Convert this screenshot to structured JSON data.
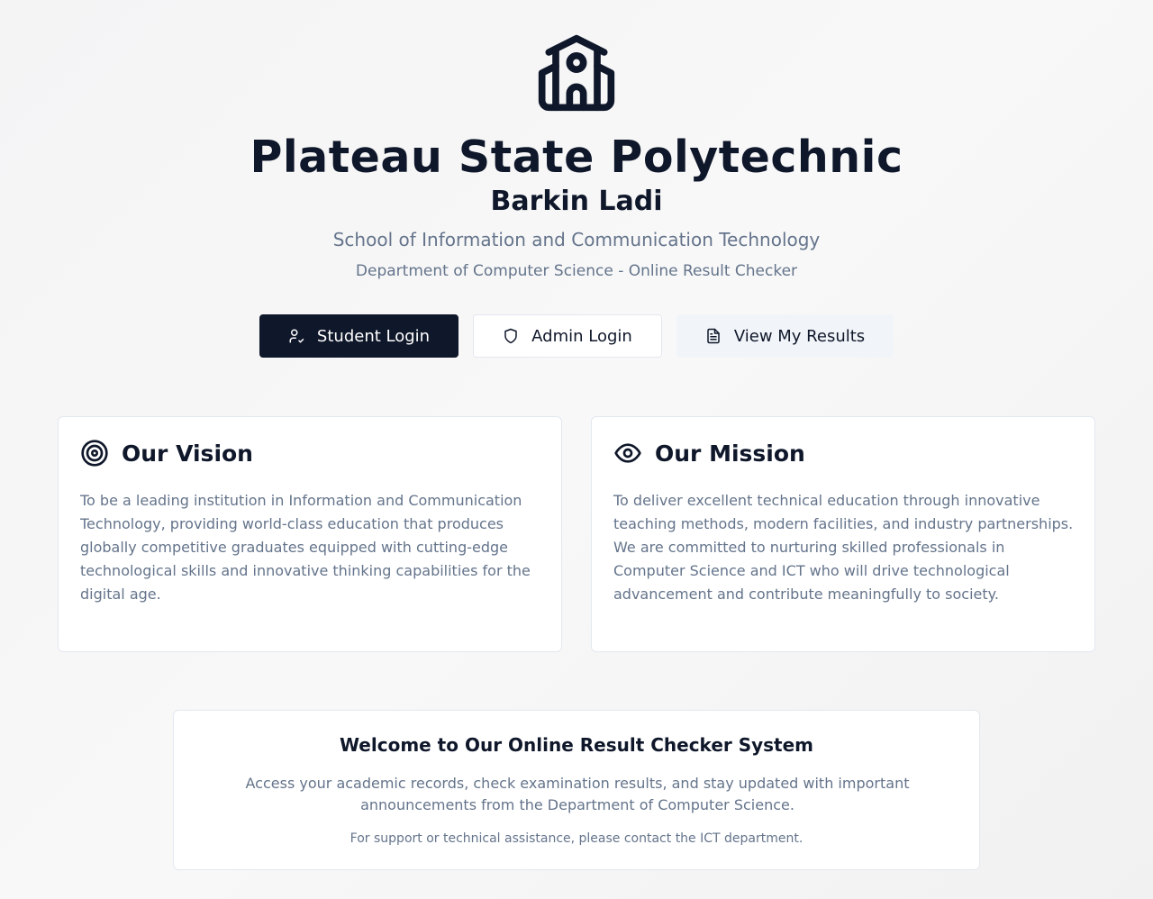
{
  "header": {
    "logo_icon": "school-building-icon",
    "title": "Plateau State Polytechnic",
    "subtitle": "Barkin Ladi",
    "school": "School of Information and Communication Technology",
    "department": "Department of Computer Science - Online Result Checker"
  },
  "actions": {
    "student_login": {
      "label": "Student Login",
      "icon": "user-check-icon"
    },
    "admin_login": {
      "label": "Admin Login",
      "icon": "shield-icon"
    },
    "view_results": {
      "label": "View My Results",
      "icon": "document-icon"
    }
  },
  "vision": {
    "icon": "target-icon",
    "title": "Our Vision",
    "text": "To be a leading institution in Information and Communication Technology, providing world-class education that produces globally competitive graduates equipped with cutting-edge technological skills and innovative thinking capabilities for the digital age."
  },
  "mission": {
    "icon": "eye-icon",
    "title": "Our Mission",
    "text": "To deliver excellent technical education through innovative teaching methods, modern facilities, and industry partnerships. We are committed to nurturing skilled professionals in Computer Science and ICT who will drive technological advancement and contribute meaningfully to society."
  },
  "welcome": {
    "title": "Welcome to Our Online Result Checker System",
    "text": "Access your academic records, check examination results, and stay updated with important announcements from the Department of Computer Science.",
    "note": "For support or technical assistance, please contact the ICT department."
  },
  "colors": {
    "primary": "#0f172a",
    "muted_text": "#64748b",
    "border": "#e2e8f0",
    "secondary_bg": "#f1f5f9"
  }
}
